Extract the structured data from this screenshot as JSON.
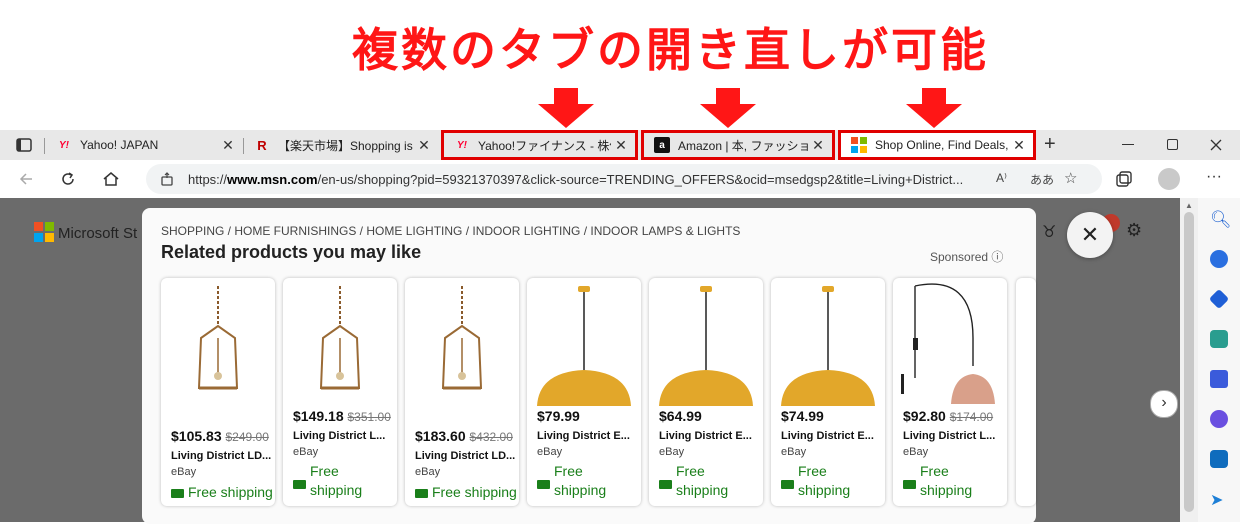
{
  "annotation": {
    "text": "複数のタブの開き直しが可能",
    "color": "#ff1616"
  },
  "tabs": [
    {
      "title": "Yahoo! JAPAN",
      "favicon": "yahoo-icon"
    },
    {
      "title": "【楽天市場】Shopping is Entertainment!",
      "favicon": "rakuten-icon"
    },
    {
      "title": "Yahoo!ファイナンス - 株価・経済ニュース",
      "favicon": "yahoo-icon"
    },
    {
      "title": "Amazon | 本, ファッション, 家電",
      "favicon": "amazon-icon"
    },
    {
      "title": "Shop Online, Find Deals, and More",
      "favicon": "microsoft-icon"
    }
  ],
  "tab_close_glyph": "✕",
  "new_tab_glyph": "+",
  "address": {
    "prefix": "https://",
    "domain": "www.msn.com",
    "path": "/en-us/shopping?pid=59321370397&click-source=TRENDING_OFFERS&ocid=msedgsp2&title=Living+District..."
  },
  "page": {
    "logo_text": "Microsoft St",
    "breadcrumbs": "SHOPPING / HOME FURNISHINGS / HOME LIGHTING / INDOOR LIGHTING / INDOOR LAMPS & LIGHTS",
    "heading": "Related products you may like",
    "sponsored": "Sponsored ⓘ"
  },
  "products": [
    {
      "price": "$105.83",
      "was": "$249.00",
      "name": "Living District LD...",
      "seller": "eBay",
      "ship1": "Free shipping",
      "ship2": "",
      "img": "cage-pendant"
    },
    {
      "price": "$149.18",
      "was": "$351.00",
      "name": "Living District L...",
      "seller": "eBay",
      "ship1": "Free",
      "ship2": "shipping",
      "img": "cage-pendant"
    },
    {
      "price": "$183.60",
      "was": "$432.00",
      "name": "Living District LD...",
      "seller": "eBay",
      "ship1": "Free shipping",
      "ship2": "",
      "img": "cage-pendant"
    },
    {
      "price": "$79.99",
      "was": "",
      "name": "Living District E...",
      "seller": "eBay",
      "ship1": "Free",
      "ship2": "shipping",
      "img": "dome-pendant"
    },
    {
      "price": "$64.99",
      "was": "",
      "name": "Living District E...",
      "seller": "eBay",
      "ship1": "Free",
      "ship2": "shipping",
      "img": "dome-pendant"
    },
    {
      "price": "$74.99",
      "was": "",
      "name": "Living District E...",
      "seller": "eBay",
      "ship1": "Free",
      "ship2": "shipping",
      "img": "dome-pendant"
    },
    {
      "price": "$92.80",
      "was": "$174.00",
      "name": "Living District L...",
      "seller": "eBay",
      "ship1": "Free",
      "ship2": "shipping",
      "img": "plug-pendant"
    }
  ],
  "colors": {
    "accent_red": "#e00000",
    "gold": "#e2a72a",
    "ship_green": "#1a7f1a"
  }
}
